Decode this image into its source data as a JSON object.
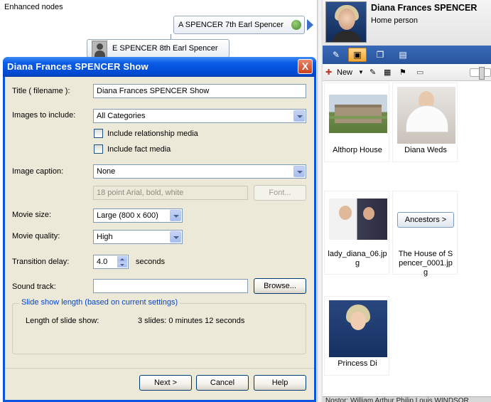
{
  "background": {
    "panel_title": "Enhanced nodes",
    "node_a": "A SPENCER 7th Earl Spencer",
    "node_e": "E SPENCER 8th Earl Spencer"
  },
  "person": {
    "name": "Diana Frances SPENCER",
    "subtitle": "Home person"
  },
  "media_toolbar": {
    "new_label": "New"
  },
  "media": [
    {
      "caption": "Althorp House"
    },
    {
      "caption": "Diana Weds"
    },
    {
      "caption": "lady_diana_06.jpg"
    },
    {
      "caption": "The House of Spencer_0001.jpg",
      "button_label": "Ancestors >"
    },
    {
      "caption": "Princess Di"
    }
  ],
  "status_text": "Nostor: William Arthur Philip Louis WINDSOR",
  "dialog": {
    "title": "Diana Frances SPENCER Show",
    "close_label": "X",
    "title_label": "Title ( filename ):",
    "title_value": "Diana Frances SPENCER Show",
    "images_label": "Images to include:",
    "images_value": "All Categories",
    "include_relationship": "Include relationship media",
    "include_fact": "Include fact media",
    "caption_label": "Image caption:",
    "caption_value": "None",
    "font_value": "18 point Arial, bold, white",
    "font_button": "Font...",
    "movie_size_label": "Movie size:",
    "movie_size_value": "Large (800 x 600)",
    "movie_quality_label": "Movie quality:",
    "movie_quality_value": "High",
    "transition_label": "Transition delay:",
    "transition_value": "4.0",
    "transition_unit": "seconds",
    "sound_label": "Sound track:",
    "sound_value": "",
    "browse_button": "Browse...",
    "group_title": "Slide show length (based on current settings)",
    "length_label": "Length of slide show:",
    "length_value": "3 slides: 0 minutes 12 seconds",
    "next_button": "Next >",
    "cancel_button": "Cancel",
    "help_button": "Help"
  }
}
